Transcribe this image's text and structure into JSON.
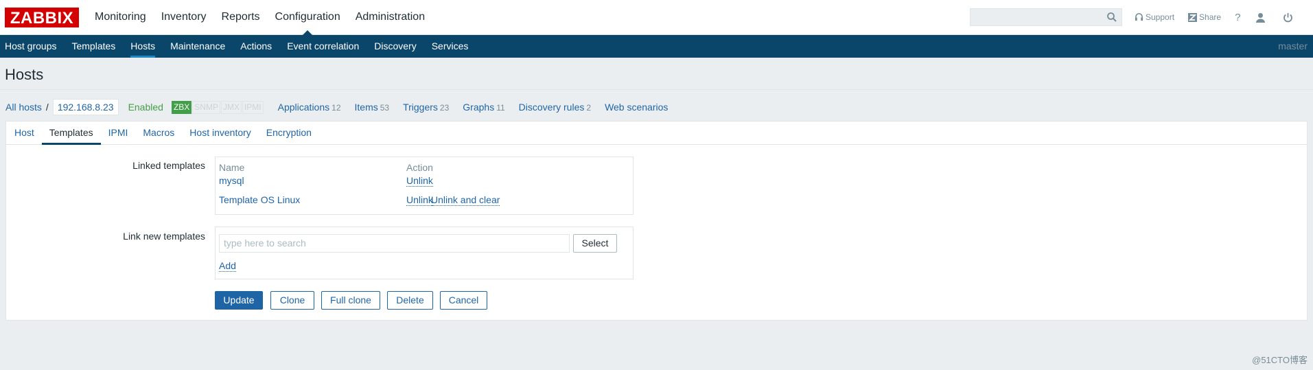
{
  "header": {
    "logo": "ZABBIX",
    "main_nav": [
      "Monitoring",
      "Inventory",
      "Reports",
      "Configuration",
      "Administration"
    ],
    "selected_main": 3,
    "support_label": "Support",
    "share_label": "Share",
    "help_label": "?"
  },
  "subnav": {
    "items": [
      "Host groups",
      "Templates",
      "Hosts",
      "Maintenance",
      "Actions",
      "Event correlation",
      "Discovery",
      "Services"
    ],
    "selected": 2,
    "server": "master"
  },
  "page": {
    "title": "Hosts"
  },
  "host_line": {
    "all_hosts": "All hosts",
    "separator": "/",
    "host": "192.168.8.23",
    "status": "Enabled",
    "badges": [
      {
        "label": "ZBX",
        "active": true
      },
      {
        "label": "SNMP",
        "active": false
      },
      {
        "label": "JMX",
        "active": false
      },
      {
        "label": "IPMI",
        "active": false
      }
    ],
    "applications": {
      "label": "Applications",
      "count": "12"
    },
    "items": {
      "label": "Items",
      "count": "53"
    },
    "triggers": {
      "label": "Triggers",
      "count": "23"
    },
    "graphs": {
      "label": "Graphs",
      "count": "11"
    },
    "discovery": {
      "label": "Discovery rules",
      "count": "2"
    },
    "web": {
      "label": "Web scenarios"
    }
  },
  "tabs": [
    "Host",
    "Templates",
    "IPMI",
    "Macros",
    "Host inventory",
    "Encryption"
  ],
  "active_tab": 1,
  "form": {
    "linked_label": "Linked templates",
    "col_name": "Name",
    "col_action": "Action",
    "linked": [
      {
        "name": "mysql",
        "actions": [
          "Unlink"
        ]
      },
      {
        "name": "Template OS Linux",
        "actions": [
          "Unlink",
          "Unlink and clear"
        ]
      }
    ],
    "link_new_label": "Link new templates",
    "search_placeholder": "type here to search",
    "select_label": "Select",
    "add_label": "Add"
  },
  "buttons": {
    "update": "Update",
    "clone": "Clone",
    "full_clone": "Full clone",
    "delete": "Delete",
    "cancel": "Cancel"
  },
  "watermark": "@51CTO博客",
  "colors": {
    "brand": "#d40000",
    "nav_bg": "#0a466a",
    "link": "#1f65a6",
    "enabled": "#429e47"
  }
}
